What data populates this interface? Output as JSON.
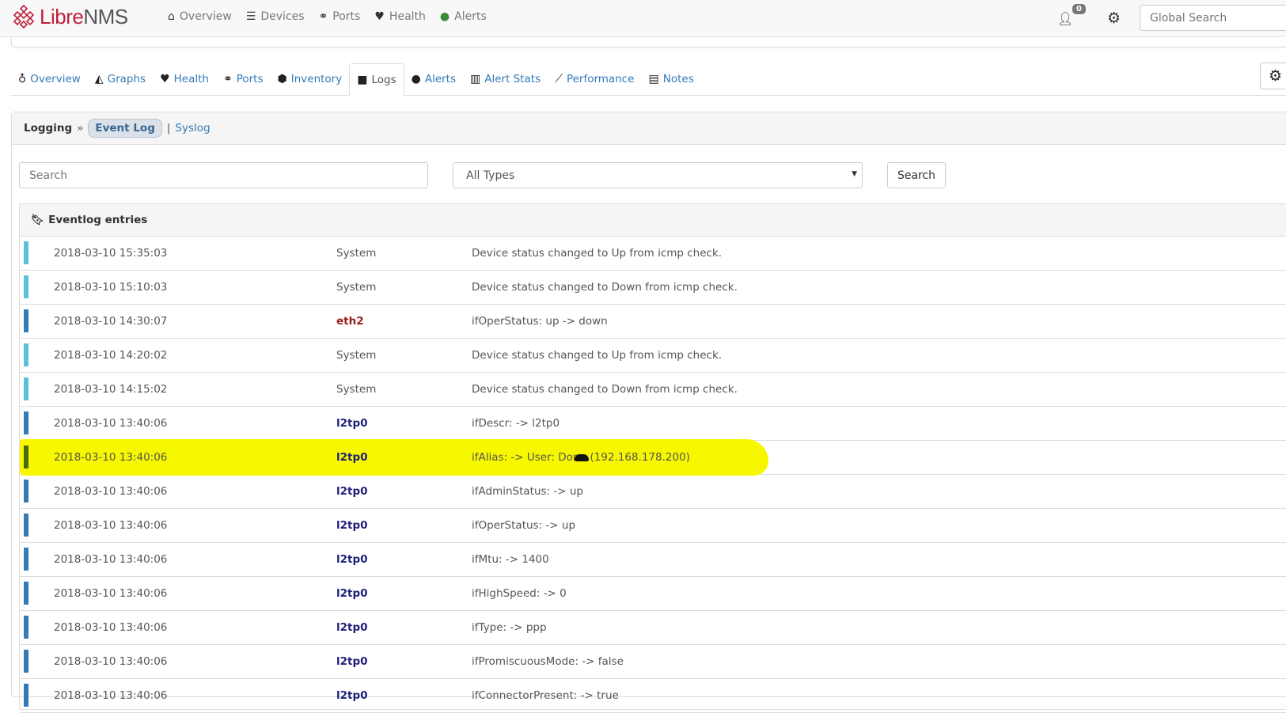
{
  "brand": {
    "part1": "Libre",
    "part2": "NMS"
  },
  "topnav": {
    "items": [
      {
        "label": "Overview",
        "icon": "home-icon"
      },
      {
        "label": "Devices",
        "icon": "server-icon"
      },
      {
        "label": "Ports",
        "icon": "link-icon"
      },
      {
        "label": "Health",
        "icon": "heartbeat-icon"
      },
      {
        "label": "Alerts",
        "icon": "exclamation-circle-icon"
      }
    ],
    "notification_count": "0",
    "global_search_placeholder": "Global Search"
  },
  "tabs": [
    {
      "label": "Overview",
      "icon": "lightbulb-icon"
    },
    {
      "label": "Graphs",
      "icon": "area-chart-icon"
    },
    {
      "label": "Health",
      "icon": "heartbeat-icon"
    },
    {
      "label": "Ports",
      "icon": "link-icon"
    },
    {
      "label": "Inventory",
      "icon": "cube-icon"
    },
    {
      "label": "Logs",
      "icon": "sticky-note-icon",
      "active": true
    },
    {
      "label": "Alerts",
      "icon": "exclamation-circle-icon"
    },
    {
      "label": "Alert Stats",
      "icon": "bar-chart-icon"
    },
    {
      "label": "Performance",
      "icon": "line-chart-icon"
    },
    {
      "label": "Notes",
      "icon": "file-text-icon"
    }
  ],
  "logging": {
    "title": "Logging",
    "sep": "»",
    "active": "Event Log",
    "divider": "|",
    "other": "Syslog"
  },
  "filters": {
    "search_placeholder": "Search",
    "type_selected": "All Types",
    "search_button": "Search"
  },
  "eventlog": {
    "title": "Eventlog entries",
    "colors": {
      "system": "#5bc0de",
      "port": "#337ab7",
      "highlight": "#f7f700"
    },
    "rows": [
      {
        "date": "2018-03-10 15:35:03",
        "type": "System",
        "msg": "Device status changed to Up from icmp check.",
        "kind": "system"
      },
      {
        "date": "2018-03-10 15:10:03",
        "type": "System",
        "msg": "Device status changed to Down from icmp check.",
        "kind": "system"
      },
      {
        "date": "2018-03-10 14:30:07",
        "type": "eth2",
        "msg": "ifOperStatus: up -> down",
        "kind": "red"
      },
      {
        "date": "2018-03-10 14:20:02",
        "type": "System",
        "msg": "Device status changed to Up from icmp check.",
        "kind": "system"
      },
      {
        "date": "2018-03-10 14:15:02",
        "type": "System",
        "msg": "Device status changed to Down from icmp check.",
        "kind": "system"
      },
      {
        "date": "2018-03-10 13:40:06",
        "type": "l2tp0",
        "msg": "ifDescr: -> l2tp0",
        "kind": "link"
      },
      {
        "date": "2018-03-10 13:40:06",
        "type": "l2tp0",
        "msg": "ifAlias: -> User: Don",
        "msg2": "(192.168.178.200)",
        "kind": "link",
        "highlight": true
      },
      {
        "date": "2018-03-10 13:40:06",
        "type": "l2tp0",
        "msg": "ifAdminStatus: -> up",
        "kind": "link"
      },
      {
        "date": "2018-03-10 13:40:06",
        "type": "l2tp0",
        "msg": "ifOperStatus: -> up",
        "kind": "link"
      },
      {
        "date": "2018-03-10 13:40:06",
        "type": "l2tp0",
        "msg": "ifMtu: -> 1400",
        "kind": "link"
      },
      {
        "date": "2018-03-10 13:40:06",
        "type": "l2tp0",
        "msg": "ifHighSpeed: -> 0",
        "kind": "link"
      },
      {
        "date": "2018-03-10 13:40:06",
        "type": "l2tp0",
        "msg": "ifType: -> ppp",
        "kind": "link"
      },
      {
        "date": "2018-03-10 13:40:06",
        "type": "l2tp0",
        "msg": "ifPromiscuousMode: -> false",
        "kind": "link"
      },
      {
        "date": "2018-03-10 13:40:06",
        "type": "l2tp0",
        "msg": "ifConnectorPresent: -> true",
        "kind": "link"
      }
    ]
  }
}
